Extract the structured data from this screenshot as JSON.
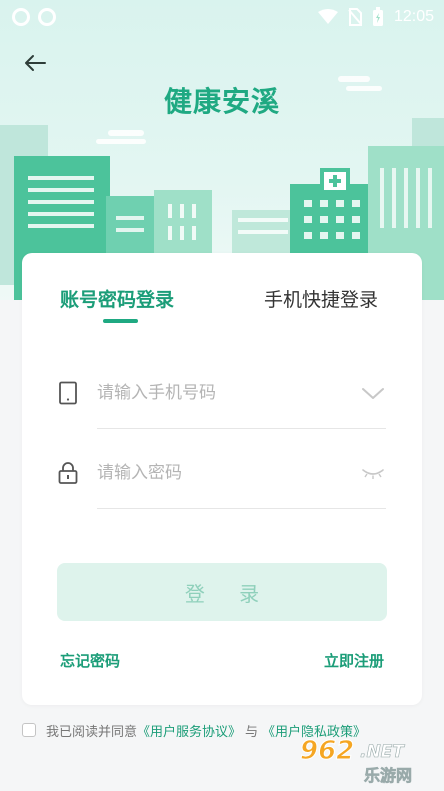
{
  "status_bar": {
    "time": "12:05"
  },
  "header": {
    "title": "健康安溪"
  },
  "tabs": [
    {
      "label": "账号密码登录",
      "active": true
    },
    {
      "label": "手机快捷登录",
      "active": false
    }
  ],
  "form": {
    "phone_placeholder": "请输入手机号码",
    "password_placeholder": "请输入密码",
    "login_label": "登 录"
  },
  "links": {
    "forgot": "忘记密码",
    "register": "立即注册"
  },
  "agreement": {
    "prefix": "我已阅读并同意",
    "service": "《用户服务协议》",
    "separator": "与",
    "privacy": "《用户隐私政策》",
    "checked": false
  },
  "watermark": {
    "brand": "962.NET",
    "site": "乐游网"
  },
  "colors": {
    "accent": "#1fa982",
    "button_bg": "#def3ec",
    "button_text": "#8fd0bb"
  }
}
